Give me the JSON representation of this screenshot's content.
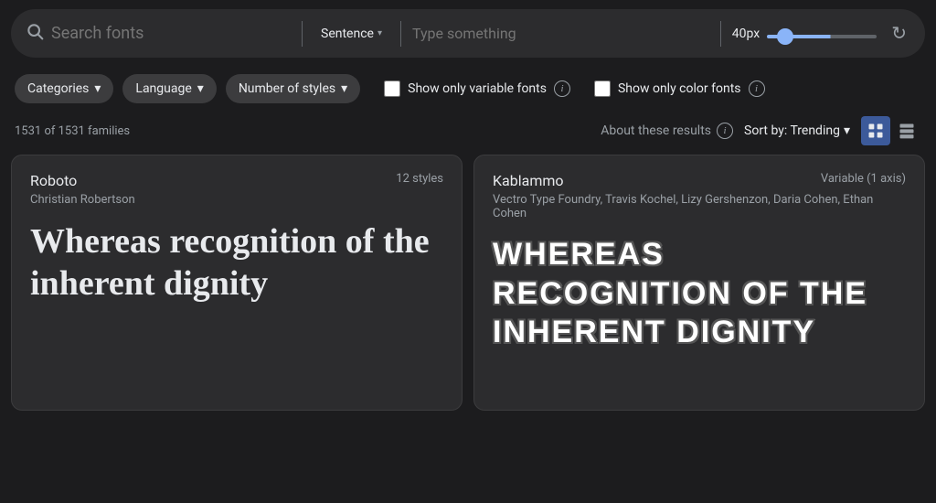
{
  "header": {
    "search_placeholder": "Search fonts",
    "sentence_label": "Sentence",
    "type_placeholder": "Type something",
    "px_value": "40px",
    "refresh_label": "Refresh"
  },
  "filters": {
    "categories_label": "Categories",
    "language_label": "Language",
    "number_of_styles_label": "Number of styles",
    "variable_fonts_label": "Show only variable fonts",
    "color_fonts_label": "Show only color fonts"
  },
  "results": {
    "count": "1531 of 1531 families",
    "about_label": "About these results",
    "sort_label": "Sort by: Trending"
  },
  "fonts": [
    {
      "name": "Roboto",
      "author": "Christian Robertson",
      "styles": "12 styles",
      "preview_text": "Whereas recognition of the inherent dignity"
    },
    {
      "name": "Kablammo",
      "author": "Vectro Type Foundry, Travis Kochel, Lizy Gershenzon, Daria Cohen, Ethan Cohen",
      "styles": "Variable (1 axis)",
      "preview_text": "WHEREAS RECOGNITION OF THE INHERENT DIGNITY"
    }
  ],
  "icons": {
    "search": "🔍",
    "dropdown_arrow": "▾",
    "info": "i",
    "refresh": "↻",
    "grid_view": "⊞",
    "list_view": "≡"
  }
}
